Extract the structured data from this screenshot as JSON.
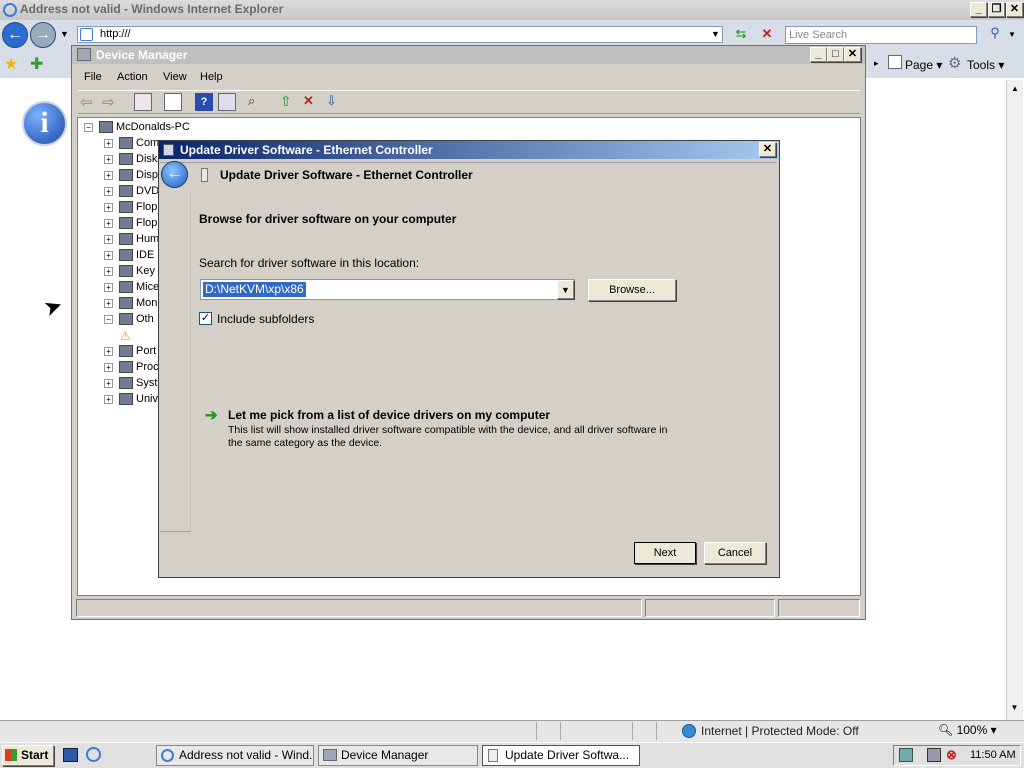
{
  "ie": {
    "title": "Address not valid - Windows Internet Explorer",
    "address": "http:///",
    "search_placeholder": "Live Search",
    "page_label": "Page",
    "tools_label": "Tools",
    "status_zone": "Internet | Protected Mode: Off",
    "zoom": "100%"
  },
  "device_manager": {
    "title": "Device Manager",
    "menus": [
      "File",
      "Action",
      "View",
      "Help"
    ],
    "tree_root": "McDonalds-PC",
    "tree_items": [
      "Com",
      "Disk",
      "Disp",
      "DVD",
      "Flop",
      "Flop",
      "Hum",
      "IDE",
      "Key",
      "Mice",
      "Mon",
      "Oth",
      "",
      "Port",
      "Proc",
      "Syst",
      "Univ"
    ]
  },
  "dialog": {
    "title": "Update Driver Software - Ethernet Controller",
    "header": "Update Driver Software - Ethernet Controller",
    "heading": "Browse for driver software on your computer",
    "search_label": "Search for driver software in this location:",
    "path_value": "D:\\NetKVM\\xp\\x86",
    "browse_label": "Browse...",
    "include_subfolders": "Include subfolders",
    "include_checked": true,
    "pick_title": "Let me pick from a list of device drivers on my computer",
    "pick_desc_1": "This list will show installed driver software compatible with the device, and all driver software in",
    "pick_desc_2": "the same category as the device.",
    "next_label": "Next",
    "cancel_label": "Cancel"
  },
  "taskbar": {
    "start_label": "Start",
    "tasks": [
      "Address not valid - Wind...",
      "Device Manager",
      "Update Driver Softwa..."
    ],
    "clock": "11:50 AM"
  },
  "colors": {
    "dialog_title_start": "#0a246a",
    "dialog_title_end": "#a6caf0",
    "selection": "#316ac5"
  }
}
